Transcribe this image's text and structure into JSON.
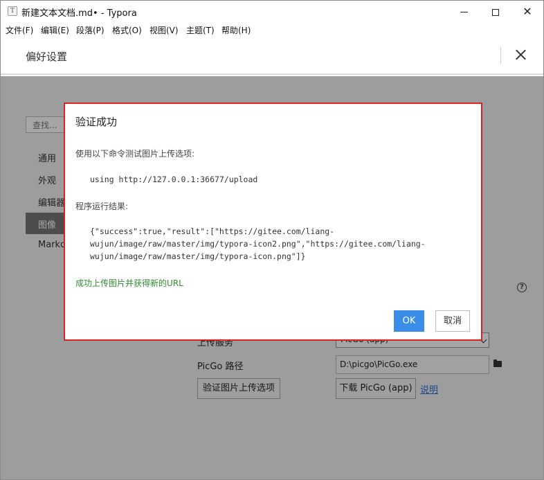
{
  "window": {
    "title": "新建文本文档.md• - Typora",
    "app_icon_letter": "T"
  },
  "menubar": {
    "items": [
      "文件(F)",
      "编辑(E)",
      "段落(P)",
      "格式(O)",
      "视图(V)",
      "主题(T)",
      "帮助(H)"
    ]
  },
  "preferences": {
    "title": "偏好设置",
    "search_placeholder": "查找...",
    "nav": [
      "通用",
      "外观",
      "编辑器",
      "图像",
      "Markdown"
    ],
    "active_nav": "图像",
    "upload_service_label": "上传服务",
    "upload_service_value": "PicGo (app)",
    "picgo_path_label": "PicGo 路径",
    "picgo_path_value": "D:\\picgo\\PicGo.exe",
    "verify_button": "验证图片上传选项",
    "download_button": "下载 PicGo (app)",
    "explain_link": "说明",
    "help_icon": "?"
  },
  "dialog": {
    "title": "验证成功",
    "command_label": "使用以下命令测试图片上传选项:",
    "command": "using http://127.0.0.1:36677/upload",
    "result_label": "程序运行结果:",
    "result_lines": [
      "{\"success\":true,\"result\":[\"https://gitee.com/liang-",
      "wujun/image/raw/master/img/typora-icon2.png\",\"https://gitee.com/liang-",
      "wujun/image/raw/master/img/typora-icon.png\"]}"
    ],
    "success_message": "成功上传图片并获得新的URL",
    "ok_button": "OK",
    "cancel_button": "取消"
  },
  "colors": {
    "dialog_border": "#e02020",
    "ok_button": "#3b8ee8",
    "success_text": "#2e8b2e",
    "link": "#2a6fd6"
  }
}
